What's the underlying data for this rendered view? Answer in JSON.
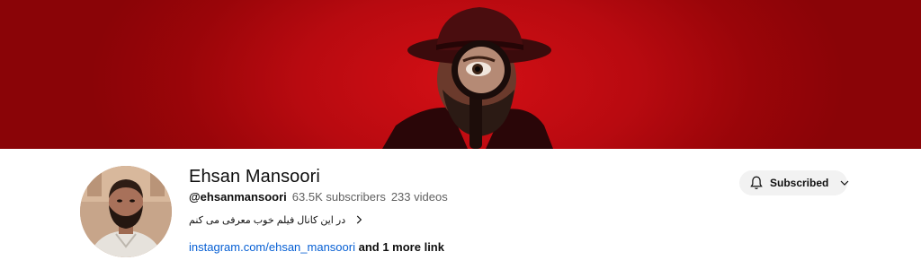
{
  "channel": {
    "name": "Ehsan Mansoori",
    "handle": "@ehsanmansoori",
    "subscribers": "63.5K subscribers",
    "videos": "233 videos",
    "description": "در این کانال فیلم خوب معرفی می کنم",
    "link_text": "instagram.com/ehsan_mansoori",
    "more_links": "and 1 more link"
  },
  "actions": {
    "subscribed_label": "Subscribed"
  },
  "icons": {
    "bell": "bell-icon",
    "chevron_down": "chevron-down-icon",
    "chevron_right": "chevron-right-icon"
  },
  "colors": {
    "banner_red": "#b80a10",
    "link_blue": "#065fd4",
    "button_bg": "#f2f2f2"
  }
}
